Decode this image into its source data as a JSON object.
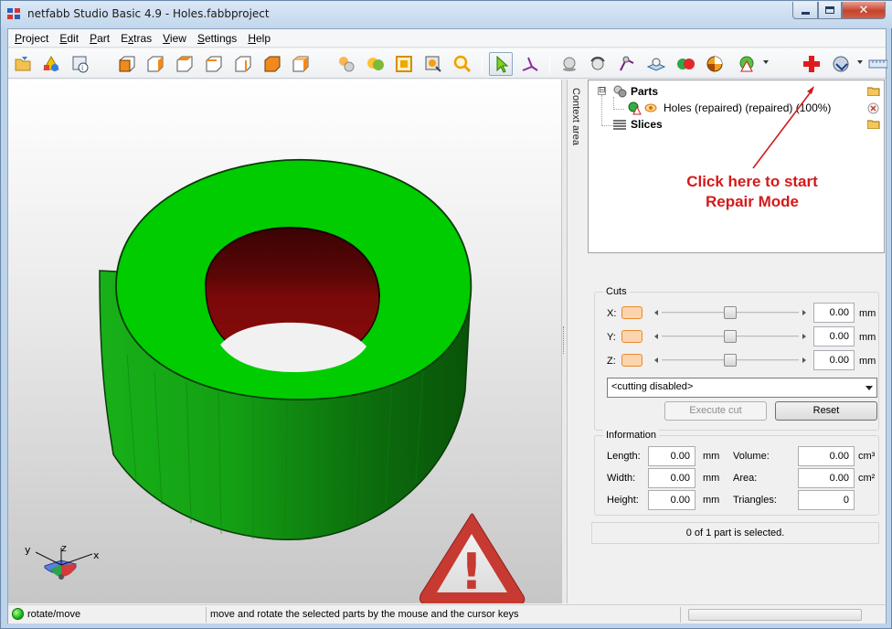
{
  "window": {
    "title": "netfabb Studio Basic 4.9 - Holes.fabbproject",
    "minimize_label": "‒",
    "maximize_label": "□",
    "close_label": "✕"
  },
  "menubar": {
    "items": [
      {
        "label": "Project",
        "mnemonic": "P"
      },
      {
        "label": "Edit",
        "mnemonic": "E"
      },
      {
        "label": "Part",
        "mnemonic": "P"
      },
      {
        "label": "Extras",
        "mnemonic": "x"
      },
      {
        "label": "View",
        "mnemonic": "V"
      },
      {
        "label": "Settings",
        "mnemonic": "S"
      },
      {
        "label": "Help",
        "mnemonic": "H"
      }
    ]
  },
  "toolbar": {
    "icons": [
      "open-icon",
      "add-part-icon",
      "part-info-icon",
      "view-front-icon",
      "view-back-icon",
      "view-left-icon",
      "view-right-icon",
      "view-top-icon",
      "view-bottom-icon",
      "view-iso-icon",
      "zoom-all-icon",
      "zoom-selected-icon",
      "zoom-platform-icon",
      "zoom-window-icon",
      "zoom-icon",
      "select-tool-icon",
      "move-tool-icon",
      "sphere-icon",
      "rotate-icon",
      "measure-icon",
      "platform-icon",
      "compare-icon",
      "pie-analysis-icon",
      "warning-view-icon",
      "repair-cross-icon",
      "export-icon",
      "ruler-icon"
    ],
    "active_tool": "select-tool-icon"
  },
  "viewport": {
    "axis_labels": {
      "x": "x",
      "y": "y",
      "z": "z"
    },
    "warning_symbol": "!",
    "colors": {
      "part_green": "#00cc00",
      "hole_red": "#7a0606",
      "warning_red": "#c8352f"
    }
  },
  "context_area": {
    "label": "Context area"
  },
  "tree": {
    "parts_label": "Parts",
    "part_name": "Holes (repaired) (repaired) (100%)",
    "slices_label": "Slices",
    "expander_parts": "⊟",
    "annotation_line1": "Click here to start",
    "annotation_line2": "Repair Mode"
  },
  "cuts": {
    "title": "Cuts",
    "axes": [
      {
        "label": "X:",
        "value": "0.00",
        "unit": "mm",
        "slider_position": 0.5
      },
      {
        "label": "Y:",
        "value": "0.00",
        "unit": "mm",
        "slider_position": 0.5
      },
      {
        "label": "Z:",
        "value": "0.00",
        "unit": "mm",
        "slider_position": 0.5
      }
    ],
    "mode_select": "<cutting disabled>",
    "execute_label": "Execute cut",
    "reset_label": "Reset"
  },
  "information": {
    "title": "Information",
    "length": {
      "label": "Length:",
      "value": "0.00",
      "unit": "mm"
    },
    "width": {
      "label": "Width:",
      "value": "0.00",
      "unit": "mm"
    },
    "height": {
      "label": "Height:",
      "value": "0.00",
      "unit": "mm"
    },
    "volume": {
      "label": "Volume:",
      "value": "0.00",
      "unit": "cm³"
    },
    "area": {
      "label": "Area:",
      "value": "0.00",
      "unit": "cm²"
    },
    "triangles": {
      "label": "Triangles:",
      "value": "0"
    }
  },
  "selection_status": "0 of 1 part is selected.",
  "statusbar": {
    "mode": "rotate/move",
    "hint": "move and rotate the selected parts by the mouse and the cursor keys"
  }
}
